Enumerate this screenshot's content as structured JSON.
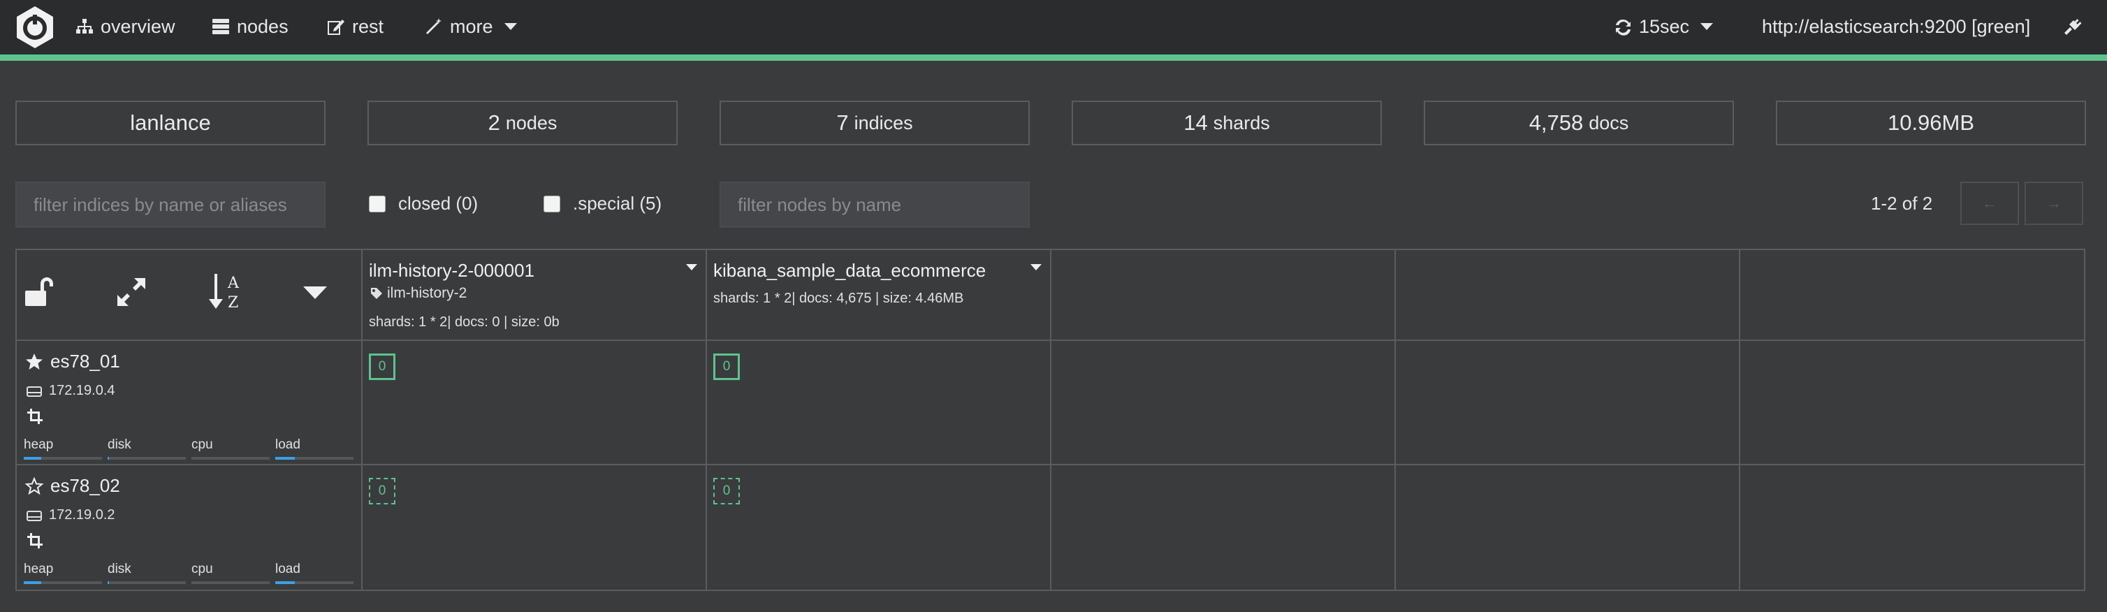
{
  "nav": {
    "overview": "overview",
    "nodes": "nodes",
    "rest": "rest",
    "more": "more",
    "refresh": "15sec",
    "connection": "http://elasticsearch:9200 [green]"
  },
  "stats": {
    "cluster_name": "lanlance",
    "nodes_value": "2",
    "nodes_unit": "nodes",
    "indices_value": "7",
    "indices_unit": "indices",
    "shards_value": "14",
    "shards_unit": "shards",
    "docs_value": "4,758",
    "docs_unit": "docs",
    "size": "10.96MB"
  },
  "filters": {
    "indices_placeholder": "filter indices by name or aliases",
    "closed_label": "closed (0)",
    "special_label": ".special (5)",
    "nodes_placeholder": "filter nodes by name",
    "pager_text": "1-2 of 2",
    "prev_label": "←",
    "next_label": "→"
  },
  "indices": [
    {
      "name": "ilm-history-2-000001",
      "alias": "ilm-history-2",
      "meta": "shards: 1 * 2| docs: 0 | size: 0b"
    },
    {
      "name": "kibana_sample_data_ecommerce",
      "meta": "shards: 1 * 2| docs: 4,675 | size: 4.46MB"
    }
  ],
  "nodes": [
    {
      "name": "es78_01",
      "master": true,
      "ip": "172.19.0.4",
      "metrics": {
        "heap": 0.22,
        "disk": 0.02,
        "cpu": 0.0,
        "load": 0.25
      }
    },
    {
      "name": "es78_02",
      "master": false,
      "ip": "172.19.0.2",
      "metrics": {
        "heap": 0.22,
        "disk": 0.02,
        "cpu": 0.0,
        "load": 0.25
      }
    }
  ],
  "metric_labels": {
    "heap": "heap",
    "disk": "disk",
    "cpu": "cpu",
    "load": "load"
  },
  "shard_label": "0",
  "colors": {
    "accent_green": "#5cc48f",
    "bar_blue": "#3aa0e6",
    "bg": "#3a3b3d",
    "topbar": "#2b2c2e"
  }
}
